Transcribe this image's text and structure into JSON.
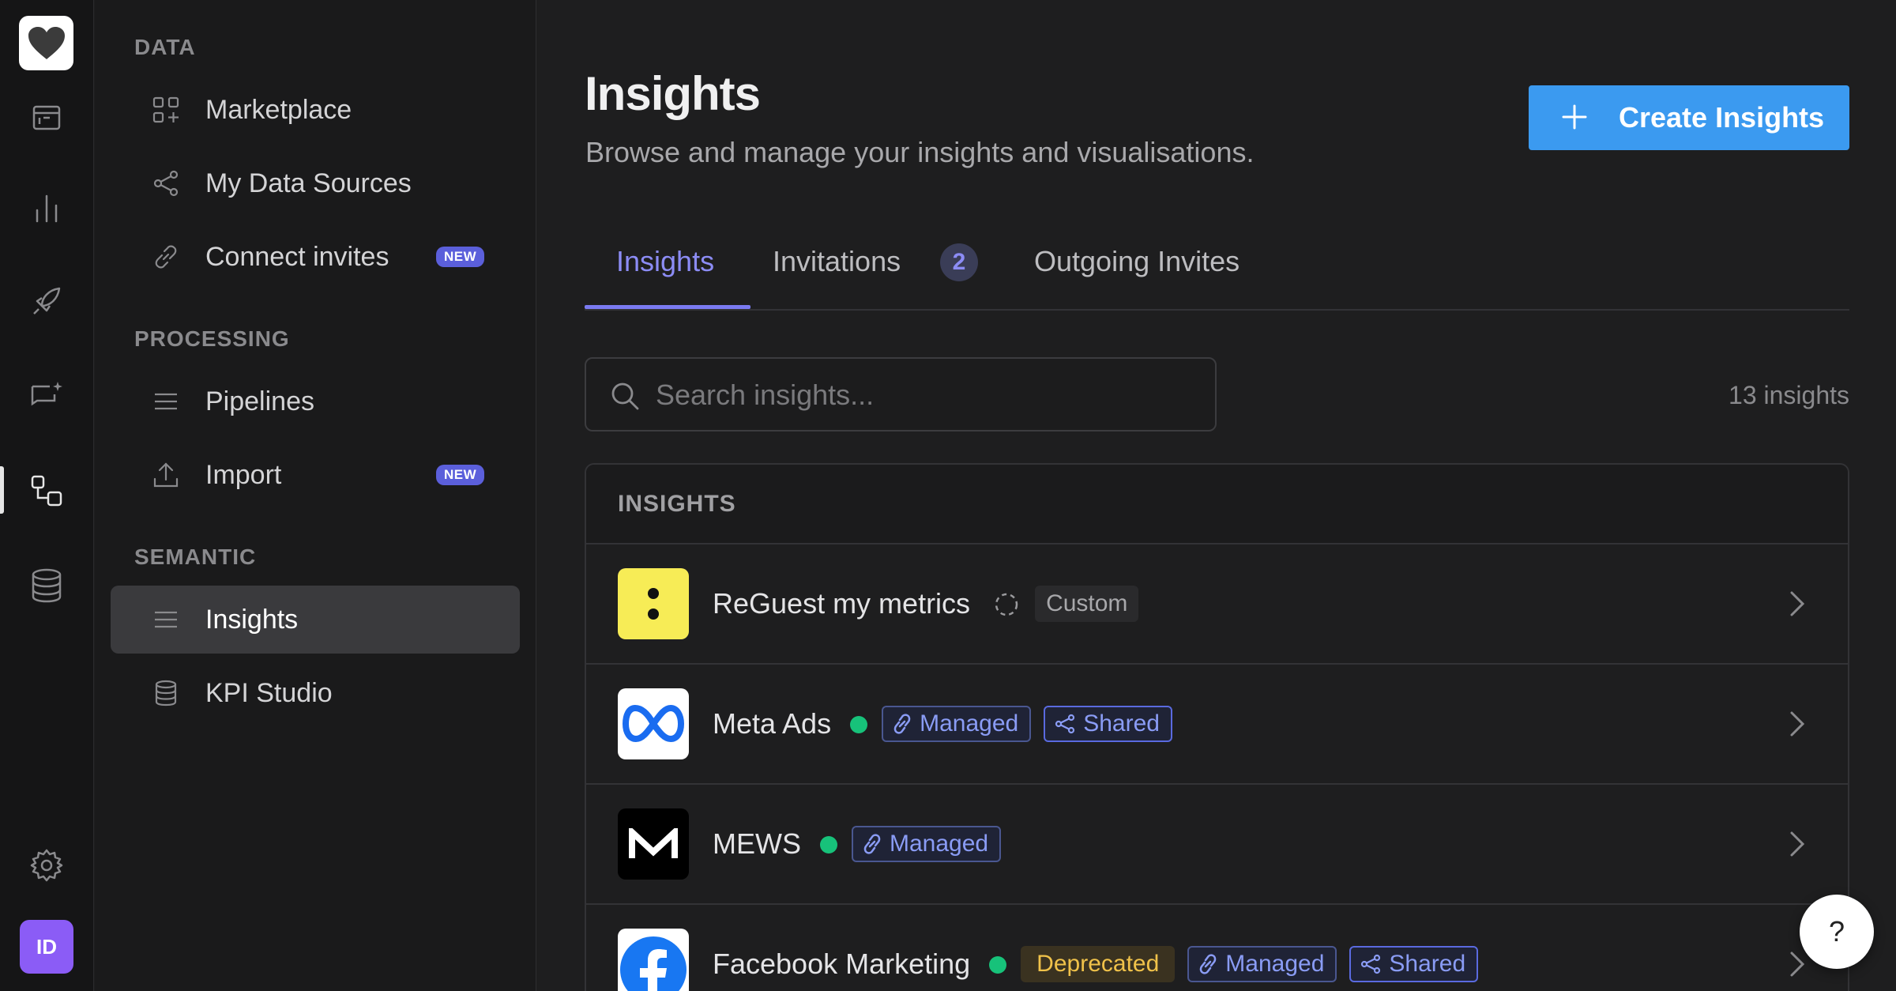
{
  "rail": {
    "avatar_initials": "ID",
    "icons": [
      "heart-logo-icon",
      "browser-window-icon",
      "bar-chart-icon",
      "rocket-icon",
      "chat-sparkle-icon",
      "connections-icon",
      "database-icon",
      "gear-icon"
    ]
  },
  "sidebar": {
    "sections": {
      "data": "DATA",
      "processing": "PROCESSING",
      "semantic": "SEMANTIC"
    },
    "items": [
      {
        "label": "Marketplace",
        "icon": "grid-plus-icon"
      },
      {
        "label": "My Data Sources",
        "icon": "share-nodes-icon"
      },
      {
        "label": "Connect invites",
        "icon": "link-icon",
        "badge": "NEW"
      },
      {
        "label": "Pipelines",
        "icon": "lines-icon"
      },
      {
        "label": "Import",
        "icon": "upload-icon",
        "badge": "NEW"
      },
      {
        "label": "Insights",
        "icon": "lines-icon",
        "active": true
      },
      {
        "label": "KPI Studio",
        "icon": "database-icon"
      }
    ]
  },
  "header": {
    "title": "Insights",
    "subtitle": "Browse and manage your insights and visualisations.",
    "create_label": "Create Insights"
  },
  "tabs": [
    {
      "label": "Insights",
      "active": true
    },
    {
      "label": "Invitations",
      "count": "2"
    },
    {
      "label": "Outgoing Invites"
    }
  ],
  "search": {
    "placeholder": "Search insights...",
    "count_label": "13 insights"
  },
  "list": {
    "header": "INSIGHTS",
    "rows": [
      {
        "name": "ReGuest my metrics",
        "status": "loading",
        "tags": [
          "Custom"
        ]
      },
      {
        "name": "Meta Ads",
        "status": "active",
        "tags": [
          "Managed",
          "Shared"
        ]
      },
      {
        "name": "MEWS",
        "status": "active",
        "tags": [
          "Managed"
        ]
      },
      {
        "name": "Facebook Marketing",
        "status": "active",
        "tags": [
          "Deprecated",
          "Managed",
          "Shared"
        ]
      }
    ]
  },
  "help": {
    "label": "?"
  },
  "colors": {
    "accent": "#3b9af0",
    "tab_active": "#8c8cf5",
    "status_green": "#17c27a",
    "new_badge": "#5b5fdb",
    "avatar": "#8b5cf6"
  }
}
